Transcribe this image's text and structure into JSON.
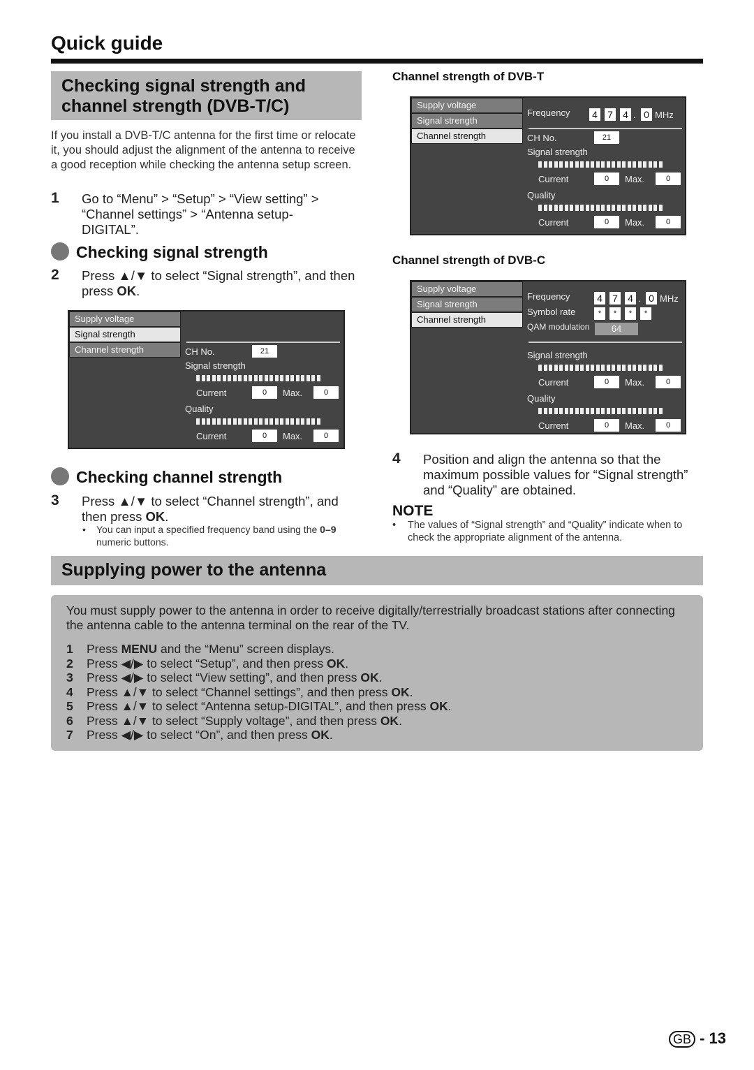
{
  "page_title": "Quick guide",
  "left": {
    "heading": "Checking signal strength and channel strength (DVB-T/C)",
    "intro": "If you install a DVB-T/C antenna for the first time or relocate it, you should adjust the alignment of the antenna to receive a good reception while checking the antenna setup screen.",
    "step1_num": "1",
    "step1": "Go to “Menu” > “Setup” > “View setting” > “Channel settings” > “Antenna setup-DIGITAL”.",
    "sub1": "Checking signal strength",
    "step2_num": "2",
    "step2_pre": "Press ▲/▼ to select “Signal strength”, and then press ",
    "step2_bold": "OK",
    "step2_post": ".",
    "sub2": "Checking channel strength",
    "step3_num": "3",
    "step3_pre": "Press ▲/▼ to select “Channel strength”, and then press ",
    "step3_bold": "OK",
    "step3_post": ".",
    "bullet_pre": "You can input a specified frequency band using the ",
    "bullet_bold": "0–9",
    "bullet_post": " numeric buttons."
  },
  "right": {
    "dvbt_title": "Channel strength of DVB-T",
    "dvbc_title": "Channel strength of DVB-C",
    "step4_num": "4",
    "step4": "Position and align the antenna so that the maximum possible values for “Signal strength” and “Quality” are obtained.",
    "note_title": "NOTE",
    "note": "The values of “Signal strength” and “Quality” indicate when to check the appropriate alignment of the antenna."
  },
  "osd": {
    "menu": [
      "Supply voltage",
      "Signal strength",
      "Channel strength"
    ],
    "frequency_label": "Frequency",
    "frequency_digits": [
      "4",
      "7",
      "4",
      "0"
    ],
    "frequency_dot": ".",
    "frequency_unit": "MHz",
    "symbol_label": "Symbol rate",
    "symbol_digits": [
      "*",
      "*",
      "*",
      "*"
    ],
    "qam_label": "QAM modulation",
    "qam_value": "64",
    "ch_label": "CH No.",
    "ch_value": "21",
    "signal_label": "Signal strength",
    "quality_label": "Quality",
    "current_label": "Current",
    "max_label": "Max.",
    "signal_current": "0",
    "signal_max": "0",
    "quality_current": "0",
    "quality_max": "0",
    "panel_signal_selected": "Signal strength",
    "panel_dvbt_selected": "Channel strength",
    "panel_dvbc_selected": "Channel strength"
  },
  "power": {
    "heading": "Supplying power to the antenna",
    "intro": "You must supply power to the antenna in order to receive digitally/terrestrially broadcast stations after connecting the antenna cable to the antenna terminal on the rear of the TV.",
    "steps": [
      {
        "n": "1",
        "pre": "Press ",
        "bold": "MENU",
        "post": " and the “Menu” screen displays.",
        "ok": ""
      },
      {
        "n": "2",
        "pre": "Press ◀/▶ to select “Setup”, and then press ",
        "bold": "OK",
        "post": "."
      },
      {
        "n": "3",
        "pre": "Press ◀/▶ to select “View setting”, and then press ",
        "bold": "OK",
        "post": "."
      },
      {
        "n": "4",
        "pre": "Press ▲/▼ to select “Channel settings”, and then press ",
        "bold": "OK",
        "post": "."
      },
      {
        "n": "5",
        "pre": "Press ▲/▼ to select “Antenna setup-DIGITAL”, and then press ",
        "bold": "OK",
        "post": "."
      },
      {
        "n": "6",
        "pre": "Press ▲/▼ to select “Supply voltage”, and then press ",
        "bold": "OK",
        "post": "."
      },
      {
        "n": "7",
        "pre": "Press ◀/▶ to select “On”, and then press ",
        "bold": "OK",
        "post": "."
      }
    ]
  },
  "footer": {
    "region": "GB",
    "separator": "-",
    "page_number": "13"
  }
}
